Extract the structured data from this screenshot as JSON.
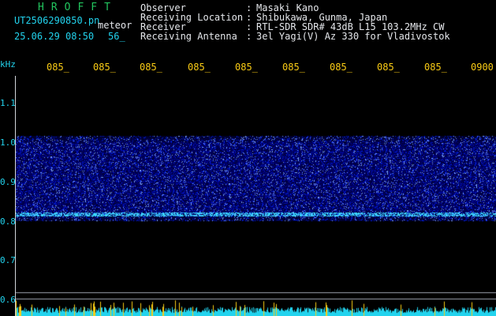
{
  "header": {
    "brand": "HROFFT",
    "file_id": "UT2506290850.pn",
    "mode": "meteor",
    "datetime": "25.06.29 08:50",
    "count": "56_"
  },
  "station_info": [
    {
      "label": "Observer",
      "value": "Masaki Kano"
    },
    {
      "label": "Receiving Location",
      "value": "Shibukawa, Gunma, Japan"
    },
    {
      "label": "Receiver",
      "value": "RTL-SDR SDR# 43dB L15 103.2MHz CW"
    },
    {
      "label": "Receiving Antenna",
      "value": "3el Yagi(V) Az 330 for Vladivostok"
    }
  ],
  "separator": ":",
  "axis": {
    "unit": "kHz",
    "y_ticks": [
      "1.1",
      "1.0",
      "0.9",
      "0.8",
      "0.7",
      "0.6"
    ],
    "x_ticks": [
      "085_",
      "085_",
      "085_",
      "085_",
      "085_",
      "085_",
      "085_",
      "085_",
      "085_",
      "0900"
    ]
  },
  "colors": {
    "background": "#000000",
    "signal_band": "#1d2fd6",
    "echo_line": "#38bdf8",
    "noise_floor": "#22d3ee",
    "meteor_spike": "#facc15"
  }
}
